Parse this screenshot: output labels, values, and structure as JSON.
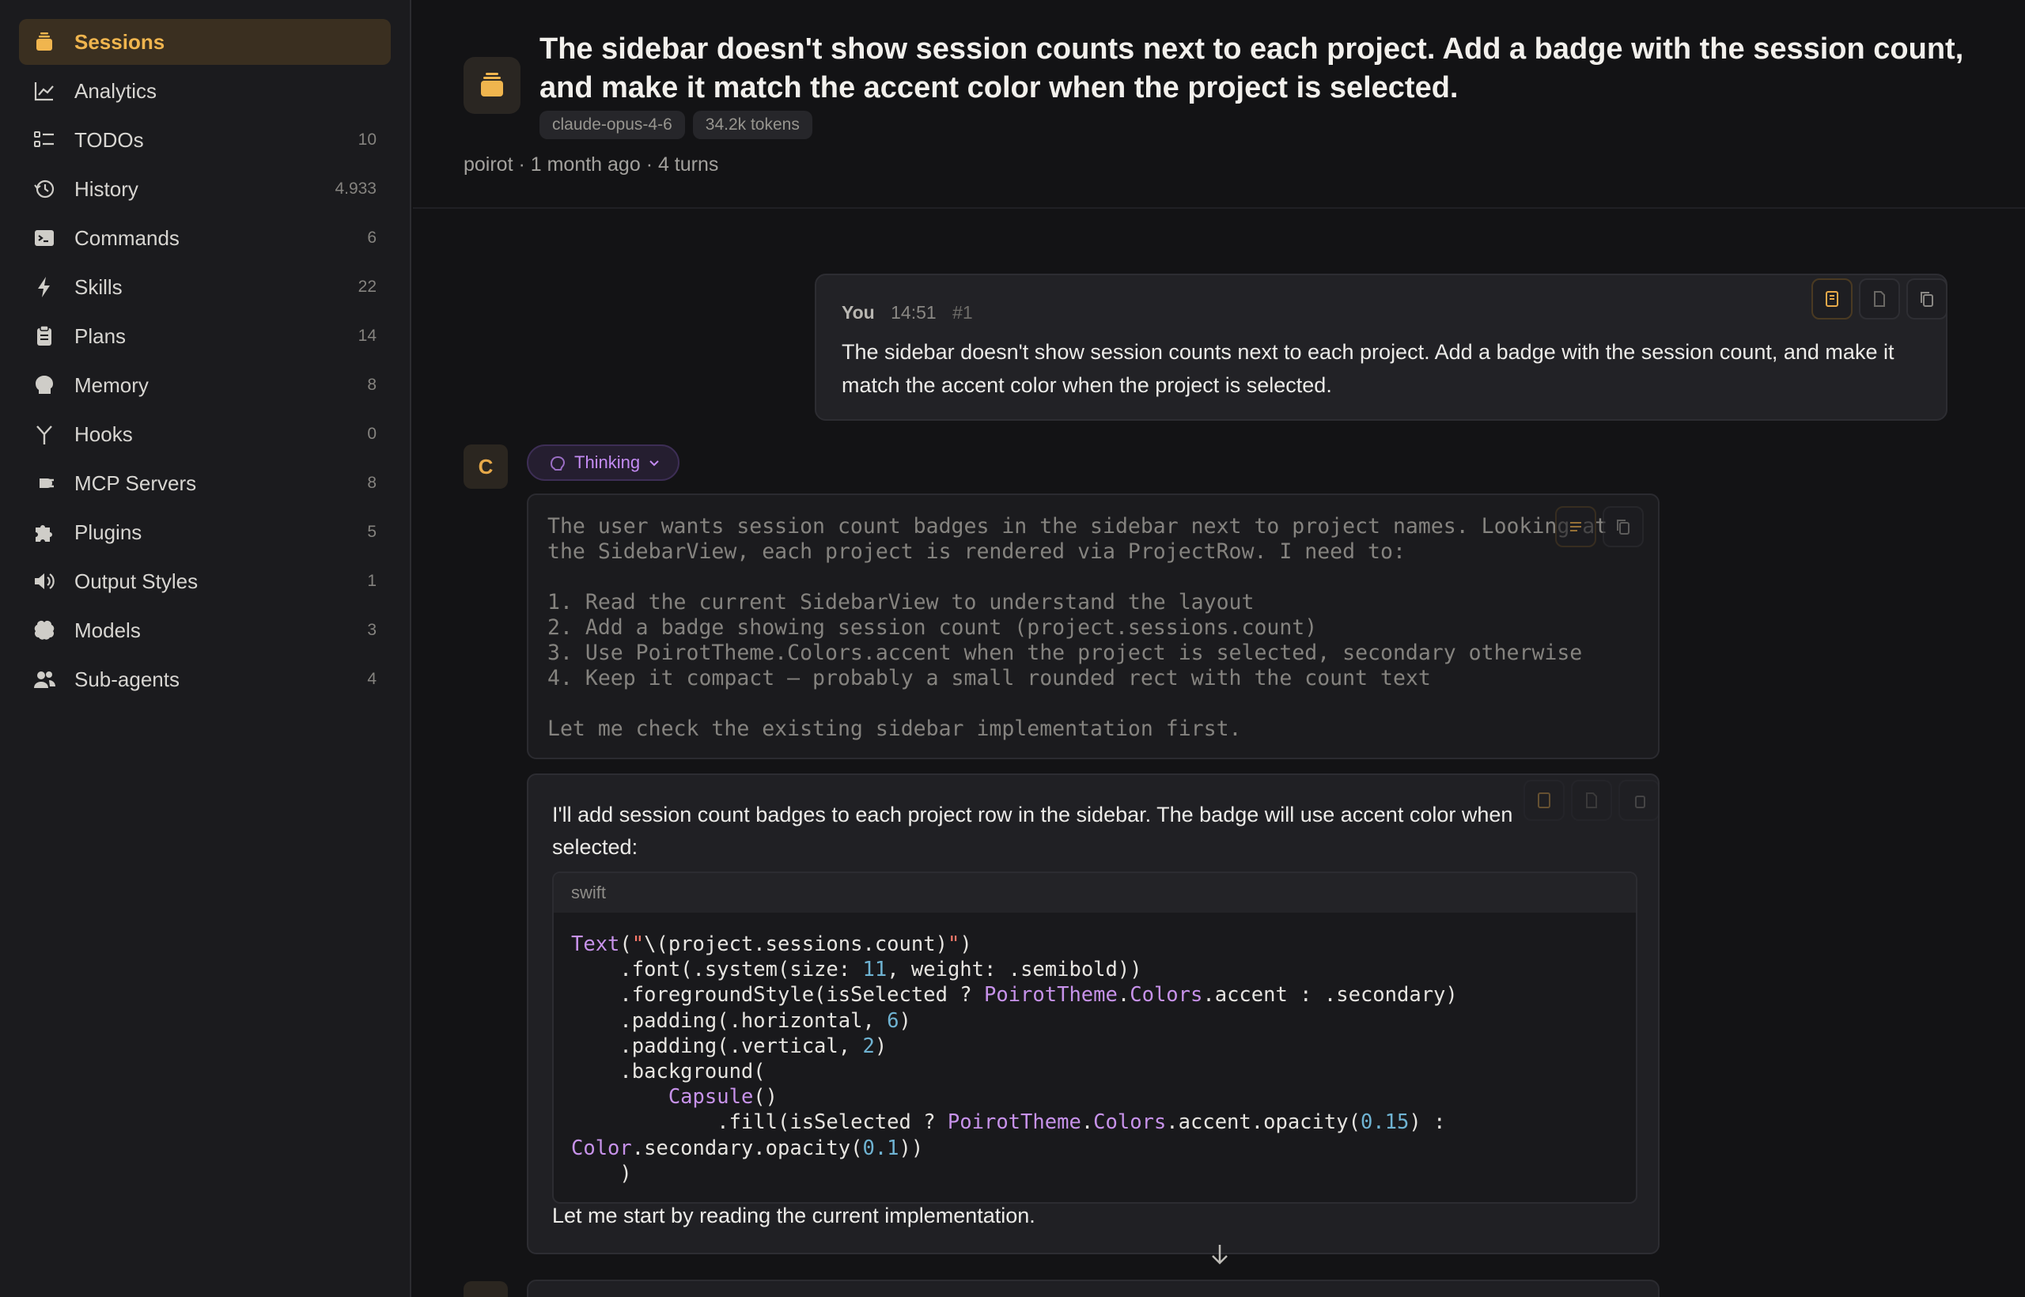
{
  "colors": {
    "accent": "#f0b54e",
    "thinking": "#c48bf3",
    "bg": "#131315",
    "sidebar_bg": "#1b1b1e"
  },
  "sidebar": {
    "items": [
      {
        "label": "Sessions",
        "count": "",
        "icon": "sessions-icon",
        "active": true
      },
      {
        "label": "Analytics",
        "count": "",
        "icon": "analytics-icon"
      },
      {
        "label": "TODOs",
        "count": "10",
        "icon": "todos-icon"
      },
      {
        "label": "History",
        "count": "4.933",
        "icon": "history-icon"
      },
      {
        "label": "Commands",
        "count": "6",
        "icon": "terminal-icon"
      },
      {
        "label": "Skills",
        "count": "22",
        "icon": "bolt-icon"
      },
      {
        "label": "Plans",
        "count": "14",
        "icon": "clipboard-icon"
      },
      {
        "label": "Memory",
        "count": "8",
        "icon": "brain-head-icon"
      },
      {
        "label": "Hooks",
        "count": "0",
        "icon": "hook-fork-icon"
      },
      {
        "label": "MCP Servers",
        "count": "8",
        "icon": "plug-icon"
      },
      {
        "label": "Plugins",
        "count": "5",
        "icon": "puzzle-icon"
      },
      {
        "label": "Output Styles",
        "count": "1",
        "icon": "speaker-icon"
      },
      {
        "label": "Models",
        "count": "3",
        "icon": "brain-icon"
      },
      {
        "label": "Sub-agents",
        "count": "4",
        "icon": "people-icon"
      }
    ]
  },
  "header": {
    "title": "The sidebar doesn't show session counts next to each project. Add a badge with the session count, and make it match the accent color when the project is selected.",
    "tags": [
      "claude-opus-4-6",
      "34.2k tokens"
    ],
    "meta": "poirot · 1 month ago · 4 turns"
  },
  "user_message": {
    "author": "You",
    "time": "14:51",
    "index": "#1",
    "text": "The sidebar doesn't show session counts next to each project. Add a badge with the session count, and make it match the accent color when the project is selected."
  },
  "assistant": {
    "avatar_letter": "C",
    "thinking_label": "Thinking",
    "thinking_text": "The user wants session count badges in the sidebar next to project names. Looking at\nthe SidebarView, each project is rendered via ProjectRow. I need to:\n\n1. Read the current SidebarView to understand the layout\n2. Add a badge showing session count (project.sessions.count)\n3. Use PoirotTheme.Colors.accent when the project is selected, secondary otherwise\n4. Keep it compact — probably a small rounded rect with the count text\n\nLet me check the existing sidebar implementation first.",
    "intro": "I'll add session count badges to each project row in the sidebar. The badge will use accent color when selected:",
    "code_lang": "swift",
    "code": "Text(\"\\(project.sessions.count)\")\n    .font(.system(size: 11, weight: .semibold))\n    .foregroundStyle(isSelected ? PoirotTheme.Colors.accent : .secondary)\n    .padding(.horizontal, 6)\n    .padding(.vertical, 2)\n    .background(\n        Capsule()\n            .fill(isSelected ? PoirotTheme.Colors.accent.opacity(0.15) :\nColor.secondary.opacity(0.1))\n    )",
    "outro": "Let me start by reading the current implementation."
  }
}
